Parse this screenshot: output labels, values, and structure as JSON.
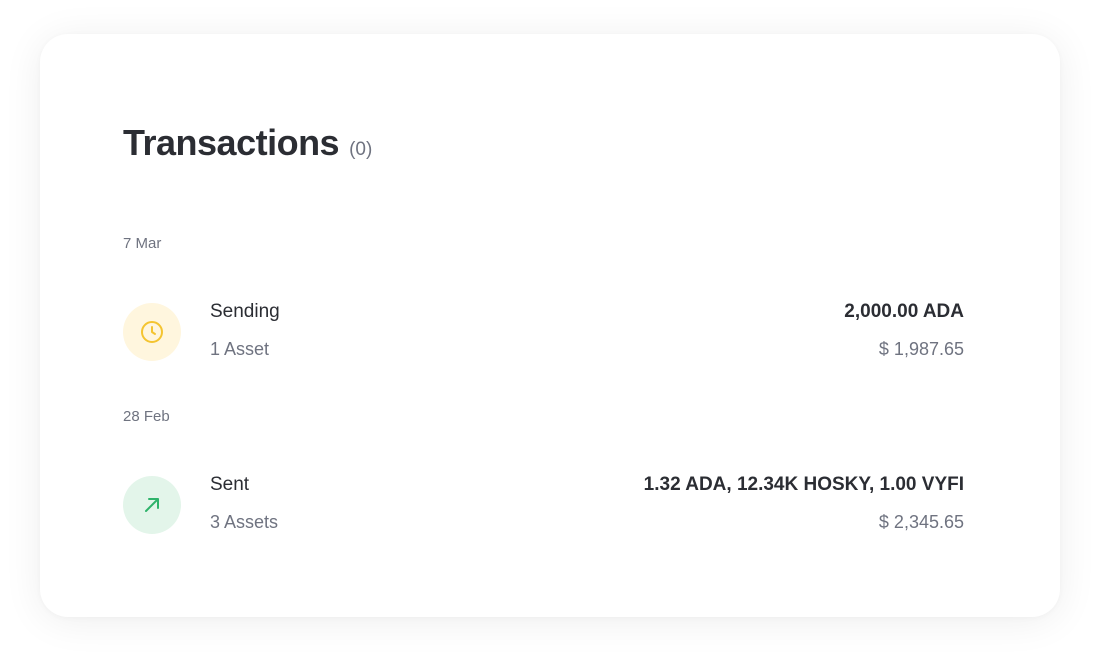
{
  "header": {
    "title": "Transactions",
    "count": "(0)"
  },
  "groups": [
    {
      "date": "7 Mar",
      "transactions": [
        {
          "status": "Sending",
          "assets": "1 Asset",
          "amount": "2,000.00 ADA",
          "fiat": "$ 1,987.65",
          "icon": "clock-icon",
          "color": "#f4c430"
        }
      ]
    },
    {
      "date": "28 Feb",
      "transactions": [
        {
          "status": "Sent",
          "assets": "3 Assets",
          "amount": "1.32 ADA, 12.34K HOSKY, 1.00 VYFI",
          "fiat": "$ 2,345.65",
          "icon": "arrow-up-right-icon",
          "color": "#2fb36b"
        }
      ]
    }
  ]
}
